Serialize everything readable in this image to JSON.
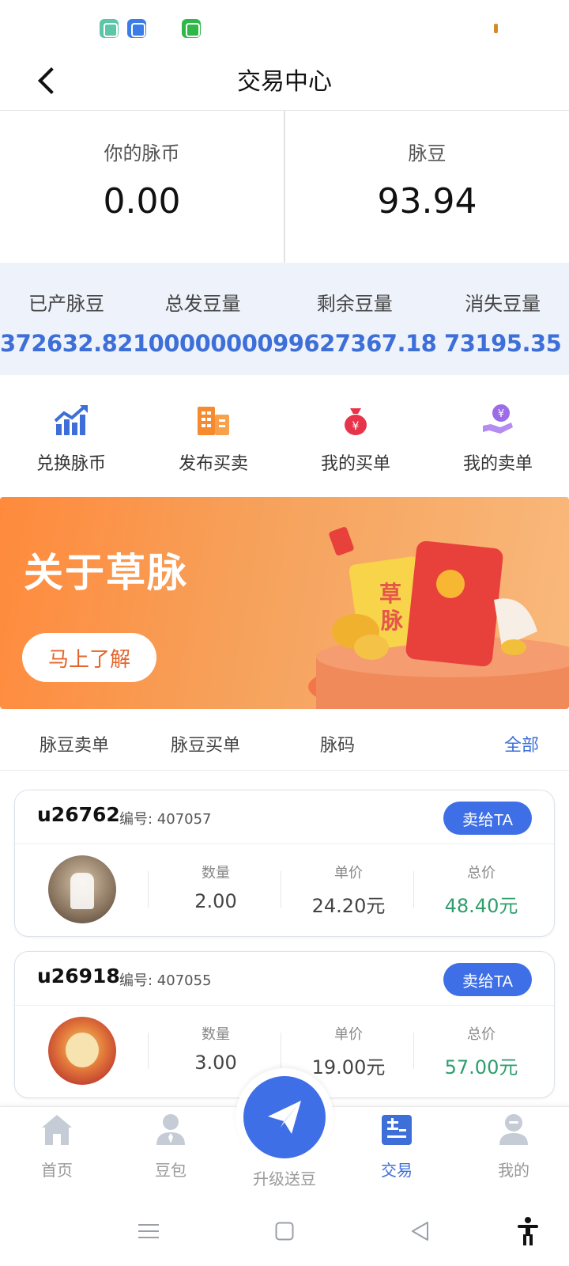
{
  "header": {
    "title": "交易中心"
  },
  "balance": {
    "coin_label": "你的脉币",
    "coin_value": "0.00",
    "bean_label": "脉豆",
    "bean_value": "93.94"
  },
  "stats": [
    {
      "label": "已产脉豆",
      "value": "372632.82"
    },
    {
      "label": "总发豆量",
      "value": "100000000"
    },
    {
      "label": "剩余豆量",
      "value": "99627367.18"
    },
    {
      "label": "消失豆量",
      "value": "73195.35"
    }
  ],
  "actions": [
    {
      "label": "兑换脉币",
      "icon": "trend-chart-icon"
    },
    {
      "label": "发布买卖",
      "icon": "building-icon"
    },
    {
      "label": "我的买单",
      "icon": "money-bag-icon"
    },
    {
      "label": "我的卖单",
      "icon": "hand-coin-icon"
    }
  ],
  "banner": {
    "title": "关于草脉",
    "button": "马上了解",
    "art_text": "草\n脉"
  },
  "tabs": [
    "脉豆卖单",
    "脉豆买单",
    "脉码",
    "全部"
  ],
  "orders": [
    {
      "user": "u26762",
      "number": "编号: 407057",
      "button": "卖给TA",
      "qty_label": "数量",
      "qty": "2.00",
      "price_label": "单价",
      "price": "24.20元",
      "total_label": "总价",
      "total": "48.40元"
    },
    {
      "user": "u26918",
      "number": "编号: 407055",
      "button": "卖给TA",
      "qty_label": "数量",
      "qty": "3.00",
      "price_label": "单价",
      "price": "19.00元",
      "total_label": "总价",
      "total": "57.00元"
    }
  ],
  "nav": {
    "home": "首页",
    "beanbag": "豆包",
    "upgrade": "升级送豆",
    "trade": "交易",
    "mine": "我的",
    "active": "交易"
  },
  "colors": {
    "accent": "#3e6fd8",
    "banner": "#ff8a3c",
    "positive": "#2d9e6c"
  }
}
